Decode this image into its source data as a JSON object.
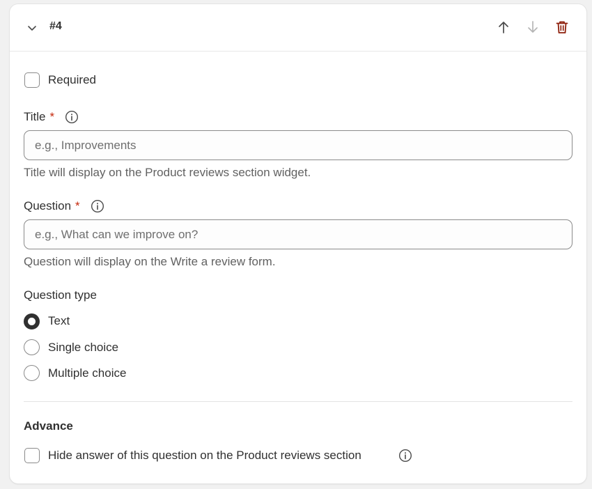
{
  "header": {
    "title": "#4"
  },
  "required": {
    "label": "Required",
    "checked": false
  },
  "title_field": {
    "label": "Title",
    "required_mark": "*",
    "placeholder": "e.g., Improvements",
    "value": "",
    "help": "Title will display on the Product reviews section widget."
  },
  "question_field": {
    "label": "Question",
    "required_mark": "*",
    "placeholder": "e.g., What can we improve on?",
    "value": "",
    "help": "Question will display on the Write a review form."
  },
  "question_type": {
    "label": "Question type",
    "options": [
      {
        "label": "Text",
        "selected": true
      },
      {
        "label": "Single choice",
        "selected": false
      },
      {
        "label": "Multiple choice",
        "selected": false
      }
    ]
  },
  "advance": {
    "title": "Advance",
    "hide_answer_label": "Hide answer of this question on the Product reviews section",
    "hide_answer_checked": false
  },
  "colors": {
    "delete": "#8e1f0b",
    "required_star": "#c5280c",
    "icon": "#4a4a4a",
    "icon_disabled": "#b5b5b5"
  }
}
